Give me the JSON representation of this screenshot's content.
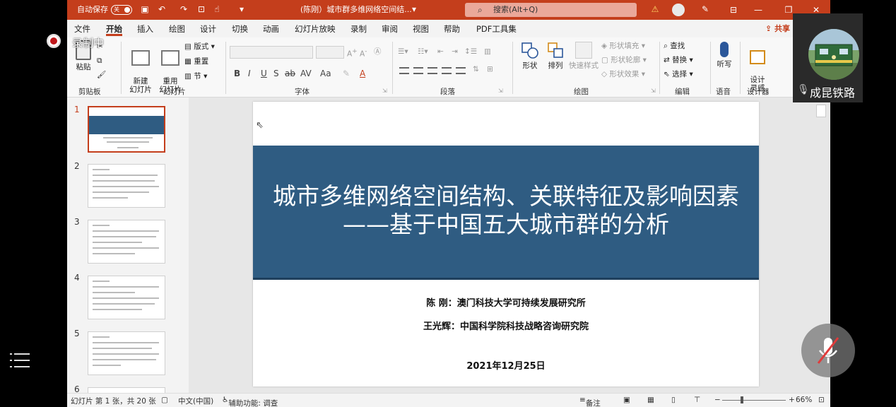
{
  "titlebar": {
    "autosave_label": "自动保存",
    "autosave_state": "关",
    "doc_title": "(陈刚）城市群多维网络空间结...",
    "search_placeholder": "搜索(Alt+Q)"
  },
  "tabs": [
    "文件",
    "开始",
    "插入",
    "绘图",
    "设计",
    "切换",
    "动画",
    "幻灯片放映",
    "录制",
    "审阅",
    "视图",
    "帮助",
    "PDF工具集"
  ],
  "active_tab": "开始",
  "share_label": "共享",
  "ribbon": {
    "clipboard": {
      "paste": "粘贴",
      "label": "剪贴板"
    },
    "slides": {
      "new_slide": "新建\n幻灯片",
      "reuse_slide": "重用\n幻灯片",
      "layout": "版式",
      "reset": "重置",
      "section": "节",
      "label": "幻灯片"
    },
    "font": {
      "buttons": [
        "B",
        "I",
        "U",
        "S",
        "ab",
        "AV",
        "Aa",
        "A"
      ],
      "label": "字体"
    },
    "paragraph": {
      "label": "段落"
    },
    "drawing": {
      "shapes": "形状",
      "arrange": "排列",
      "quick_styles": "快速样式",
      "shape_fill": "形状填充",
      "shape_outline": "形状轮廓",
      "shape_effects": "形状效果",
      "label": "绘图"
    },
    "editing": {
      "find": "查找",
      "replace": "替换",
      "select": "选择",
      "label": "编辑"
    },
    "voice": {
      "dictate": "听写",
      "label": "语音"
    },
    "designer": {
      "design_ideas": "设计\n灵感",
      "label": "设计器"
    }
  },
  "thumbnails": [
    {
      "num": "1",
      "selected": true
    },
    {
      "num": "2",
      "selected": false
    },
    {
      "num": "3",
      "selected": false
    },
    {
      "num": "4",
      "selected": false
    },
    {
      "num": "5",
      "selected": false
    },
    {
      "num": "6",
      "selected": false
    }
  ],
  "slide": {
    "title": "城市多维网络空间结构、关联特征及影响因素——基于中国五大城市群的分析",
    "author1": "陈  刚：澳门科技大学可持续发展研究所",
    "author2": "王光辉：中国科学院科技战略咨询研究院",
    "date": "2021年12月25日",
    "banner_color": "#2f5c82"
  },
  "statusbar": {
    "slide_info": "幻灯片 第 1 张，共 20 张",
    "language": "中文(中国)",
    "accessibility": "辅助功能: 调查",
    "notes": "备注",
    "zoom": "66%"
  },
  "overlay": {
    "recording_label": "录制中",
    "participant_name": "成昆铁路"
  },
  "colors": {
    "accent": "#c43e1c",
    "slide_banner": "#2f5c82"
  }
}
